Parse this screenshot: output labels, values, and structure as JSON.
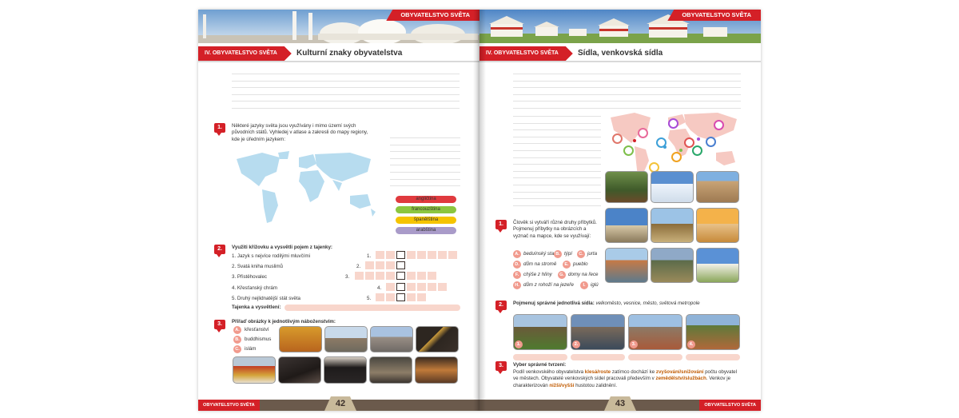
{
  "left": {
    "header_tag": "OBYVATELSTVO SVĚTA",
    "section_label": "IV. OBYVATELSTVO SVĚTA",
    "title": "Kulturní znaky obyvatelstva",
    "task1": {
      "number": "1.",
      "text": "Některé jazyky světa jsou využívány i mimo území svých původních států. Vyhledej v atlase a zakresli do mapy regiony, kde je úředním jazykem:",
      "legend": [
        {
          "label": "angličtina",
          "color": "#e03a3e"
        },
        {
          "label": "francouzština",
          "color": "#8cc63f"
        },
        {
          "label": "španělština",
          "color": "#f5c400"
        },
        {
          "label": "arabština",
          "color": "#a99bc9"
        }
      ]
    },
    "task2": {
      "number": "2.",
      "heading": "Využiti křížovku a vysvětli pojem z tajenky:",
      "clues": [
        "1. Jazyk s nejvíce rodilými mluvčími",
        "2. Svatá kniha muslimů",
        "3. Přistěhovalec",
        "4. Křesťanský chrám",
        "5. Druhý nejlidnatější stát světa"
      ],
      "row_numbers": [
        "1.",
        "2.",
        "3.",
        "4.",
        "5."
      ],
      "secret_label": "Tajenka a vysvětlení:"
    },
    "task3": {
      "number": "3.",
      "heading": "Přiřaď obrázky k jednotlivým náboženstvím:",
      "options": [
        {
          "letter": "A.",
          "label": "křesťanství"
        },
        {
          "letter": "B.",
          "label": "buddhismus"
        },
        {
          "letter": "C.",
          "label": "islám"
        }
      ]
    },
    "footer_label": "OBYVATELSTVO SVĚTA",
    "page_number": "42"
  },
  "right": {
    "header_tag": "OBYVATELSTVO SVĚTA",
    "section_label": "IV. OBYVATELSTVO SVĚTA",
    "title": "Sídla, venkovská sídla",
    "task1": {
      "number": "1.",
      "text": "Člověk si vytváří různé druhy příbytků. Pojmenuj příbytky na obrázcích a vyznač na mapce, kde se využívají:",
      "options": [
        {
          "letter": "A.",
          "label": "beduínský stan"
        },
        {
          "letter": "B.",
          "label": "týpí"
        },
        {
          "letter": "C.",
          "label": "jurta"
        },
        {
          "letter": "D.",
          "label": "dům na stromě"
        },
        {
          "letter": "E.",
          "label": "pueblo"
        },
        {
          "letter": "F.",
          "label": "chýše z hlíny"
        },
        {
          "letter": "G.",
          "label": "domy na řece"
        },
        {
          "letter": "H.",
          "label": "dům z rohoží na jezeře"
        },
        {
          "letter": "I.",
          "label": "iglú"
        }
      ]
    },
    "task2": {
      "number": "2.",
      "heading": "Pojmenuj správné jednotlivá sídla:",
      "heading_options": "velkoměsto, vesnice, město, světová metropole",
      "photo_numbers": [
        "1.",
        "2.",
        "3.",
        "4."
      ]
    },
    "task3": {
      "number": "3.",
      "heading": "Vyber správné tvrzení:",
      "line1a": "Podíl venkovského obyvatelstva ",
      "line1b": "klesá/roste",
      "line1c": " zatímco dochází ke ",
      "line1d": "zvyšování/snižování",
      "line1e": " počtu obyvatel ve městech. Obyvatelé venkovských sídel pracovali především v ",
      "line1f": "zemědělství/službách",
      "line1g": ". Venkov je charakterizován ",
      "line1h": "nižší/vyšší",
      "line1i": " hustotou zalidnění."
    },
    "footer_label": "OBYVATELSTVO SVĚTA",
    "page_number": "43"
  }
}
